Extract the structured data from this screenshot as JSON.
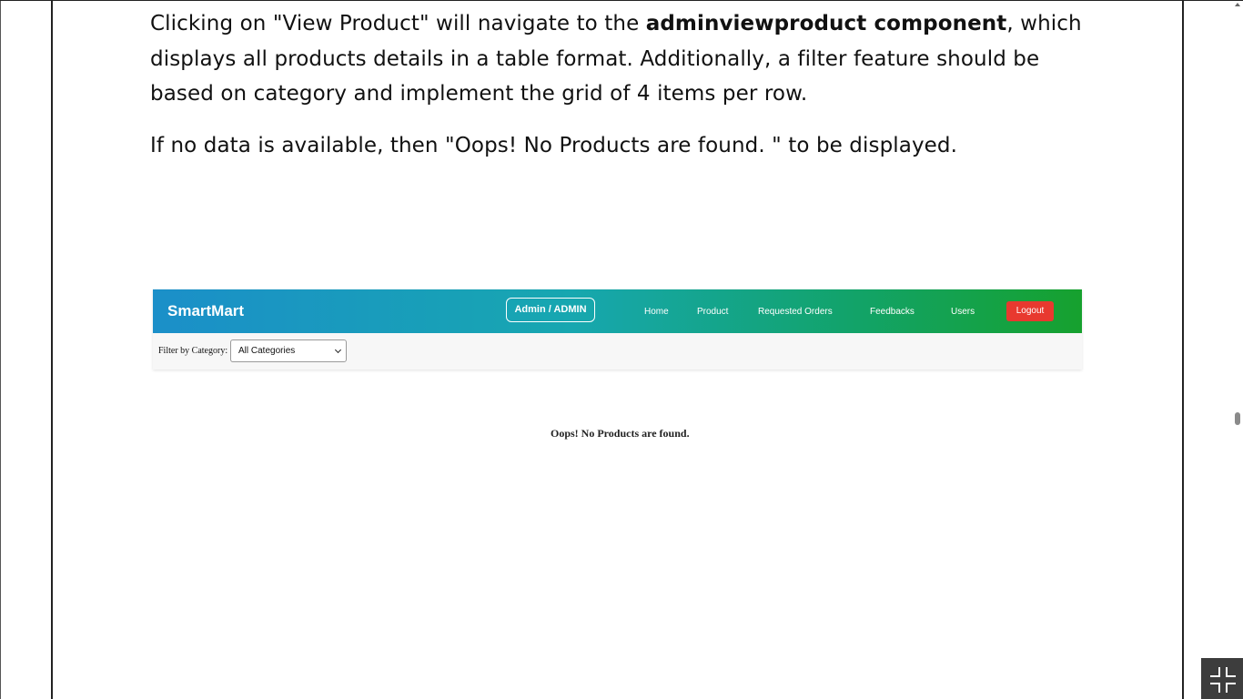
{
  "document": {
    "paragraph1": {
      "before_bold": "Clicking on \"View Product\" will navigate to the ",
      "bold": "adminviewproduct component",
      "after_bold": ", which displays all products details in a table format. Additionally, a filter feature should be based on category and implement the grid of 4 items per row."
    },
    "paragraph2": "If no data is available, then \"Oops! No Products are found. \" to be displayed."
  },
  "screenshot": {
    "navbar": {
      "brand": "SmartMart",
      "admin_badge": "Admin / ADMIN",
      "links": [
        "Home",
        "Product",
        "Requested Orders",
        "Feedbacks",
        "Users"
      ],
      "logout": "Logout"
    },
    "filter": {
      "label": "Filter by Category:",
      "selected": "All Categories"
    },
    "empty_message": "Oops! No Products are found."
  },
  "colors": {
    "navbar_gradient_start": "#1b8fc9",
    "navbar_gradient_end": "#16a12e",
    "logout_button": "#e8392f"
  },
  "icons": {
    "exit_fullscreen": "exit-fullscreen-icon",
    "select_chevron": "chevron-down-icon",
    "scroll_up": "scroll-up-arrow-icon"
  }
}
